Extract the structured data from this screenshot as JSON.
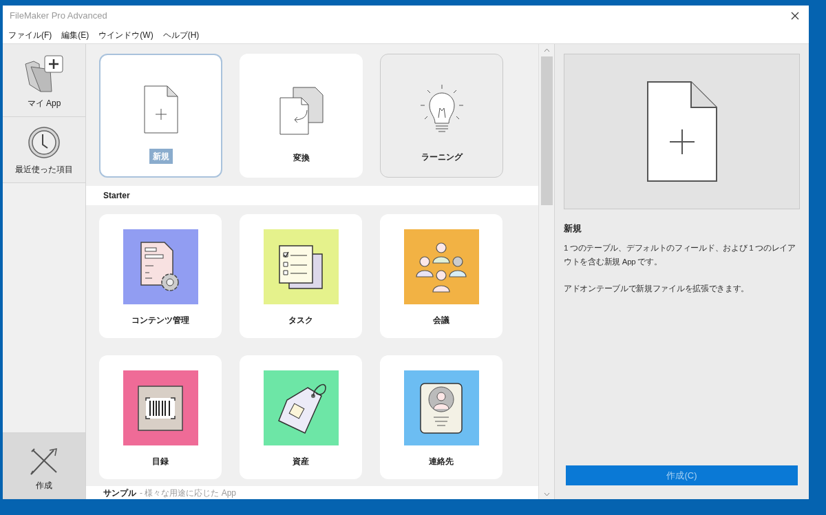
{
  "window": {
    "title": "FileMaker Pro Advanced"
  },
  "menu": [
    {
      "label": "ファイル(F)"
    },
    {
      "label": "編集(E)"
    },
    {
      "label": "ウインドウ(W)"
    },
    {
      "label": "ヘルプ(H)"
    }
  ],
  "sidebar": {
    "items": [
      {
        "label": "マイ App",
        "kind": "my-app",
        "selected": false
      },
      {
        "label": "最近使った項目",
        "kind": "recent",
        "selected": false
      },
      {
        "label": "作成",
        "kind": "create",
        "selected": true
      }
    ]
  },
  "top_cards": [
    {
      "label": "新規",
      "kind": "new",
      "selected": true,
      "hovered": false
    },
    {
      "label": "変換",
      "kind": "convert",
      "selected": false,
      "hovered": false
    },
    {
      "label": "ラーニング",
      "kind": "learning",
      "selected": false,
      "hovered": true
    }
  ],
  "starter": {
    "heading": "Starter",
    "cards": [
      {
        "label": "コンテンツ管理",
        "kind": "content",
        "color": "#919df2"
      },
      {
        "label": "タスク",
        "kind": "tasks",
        "color": "#e5f28c"
      },
      {
        "label": "会議",
        "kind": "meeting",
        "color": "#f2b244"
      },
      {
        "label": "目録",
        "kind": "inventory",
        "color": "#ef6b97"
      },
      {
        "label": "資産",
        "kind": "assets",
        "color": "#6de6a6"
      },
      {
        "label": "連絡先",
        "kind": "contacts",
        "color": "#6cbdf2"
      }
    ]
  },
  "sample": {
    "heading": "サンプル",
    "subtitle": "- 様々な用途に応じた App"
  },
  "details": {
    "title": "新規",
    "paragraphs": [
      "1 つのテーブル、デフォルトのフィールド、および 1 つのレイアウトを含む新規 App です。",
      "アドオンテーブルで新規ファイルを拡張できます。"
    ]
  },
  "create_button": {
    "label": "作成(C)"
  }
}
